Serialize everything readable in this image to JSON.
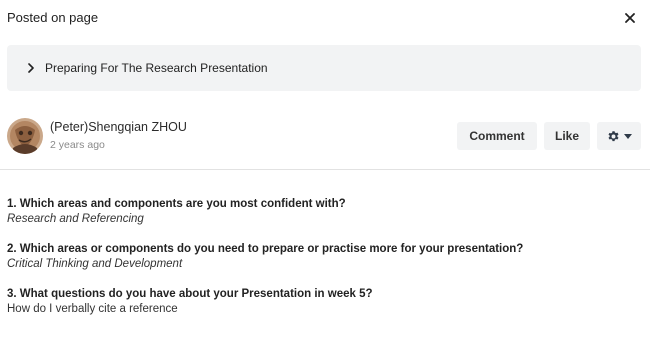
{
  "header": {
    "title": "Posted on page",
    "close_icon": "close-icon"
  },
  "page_link": {
    "title": "Preparing For The Research Presentation",
    "icon": "chevron-right-icon"
  },
  "post": {
    "author": "(Peter)Shengqian ZHOU",
    "timestamp": "2 years ago",
    "actions": {
      "comment_label": "Comment",
      "like_label": "Like",
      "settings_icon": "gear-icon"
    }
  },
  "content": {
    "items": [
      {
        "question": "1. Which areas and components are you most confident with?",
        "answer": "Research and Referencing",
        "answer_italic": true
      },
      {
        "question": "2. Which areas or components do you need to prepare or practise more for your presentation?",
        "answer": "Critical Thinking and Development",
        "answer_italic": true
      },
      {
        "question": "3. What questions do you have about your Presentation in week 5?",
        "answer": "How do I verbally cite a reference",
        "answer_italic": false
      }
    ]
  }
}
